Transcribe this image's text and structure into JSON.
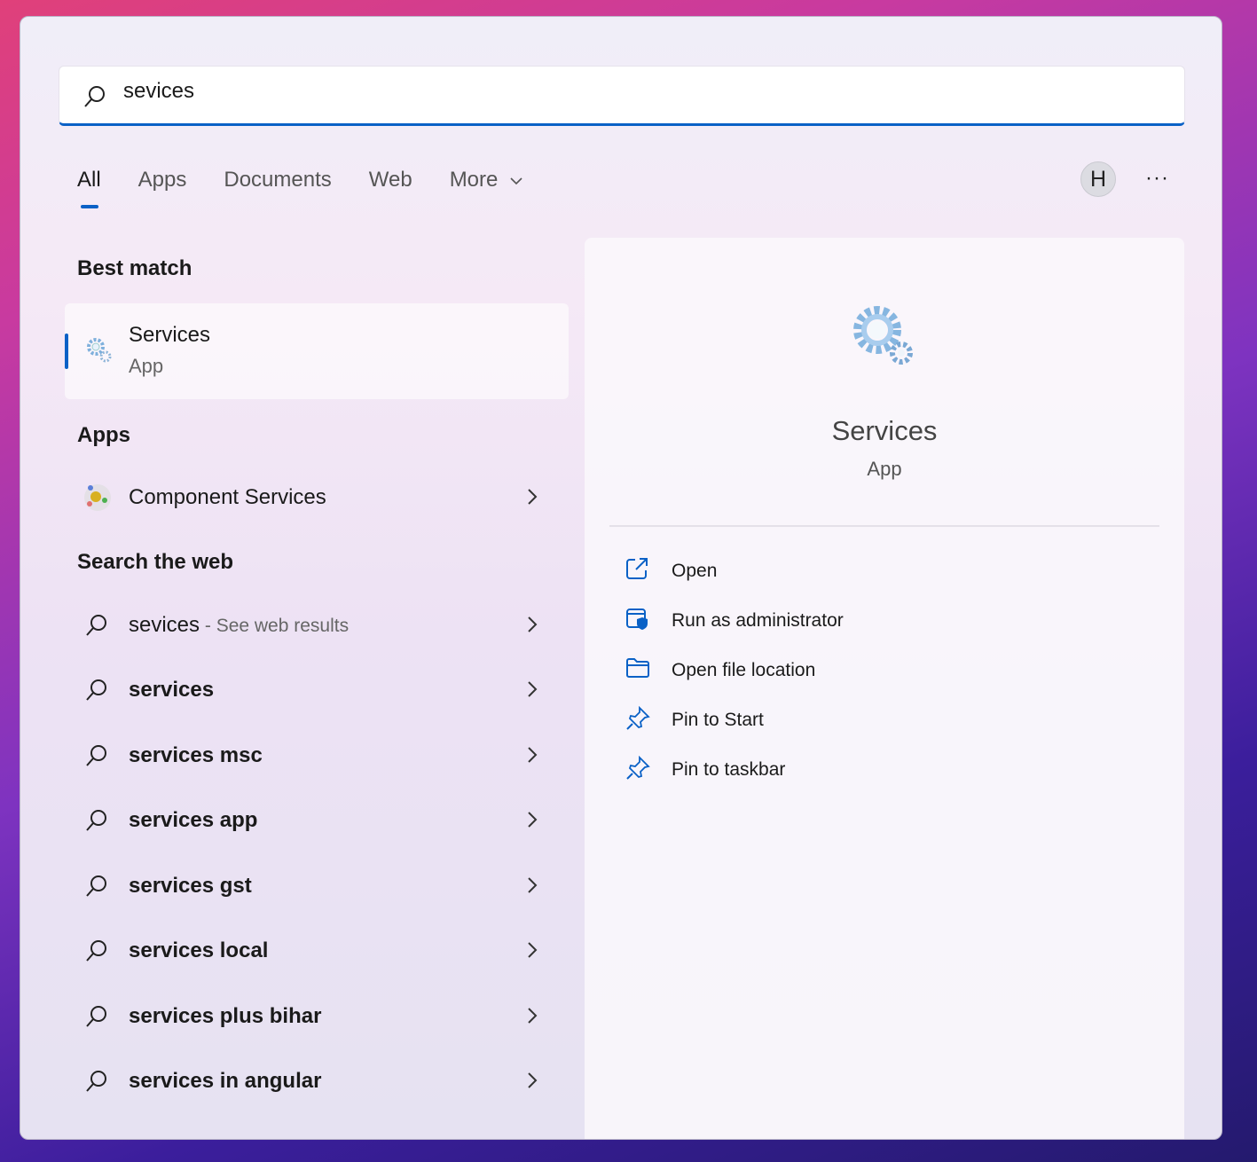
{
  "search": {
    "value": "sevices"
  },
  "tabs": [
    {
      "label": "All",
      "active": true
    },
    {
      "label": "Apps"
    },
    {
      "label": "Documents"
    },
    {
      "label": "Web"
    },
    {
      "label": "More"
    }
  ],
  "user": {
    "avatar_initial": "H",
    "more_options": "···"
  },
  "best_match": {
    "heading": "Best match",
    "title": "Services",
    "subtitle": "App",
    "icon": "services-gears-icon"
  },
  "apps": {
    "heading": "Apps",
    "items": [
      {
        "label": "Component Services",
        "icon": "component-services-icon"
      }
    ]
  },
  "web": {
    "heading": "Search the web",
    "first": {
      "query": "sevices",
      "suffix": " - See web results"
    },
    "suggestions": [
      "services",
      "services msc",
      "services app",
      "services gst",
      "services local",
      "services plus bihar",
      "services in angular"
    ]
  },
  "detail": {
    "title": "Services",
    "subtitle": "App",
    "actions": [
      {
        "label": "Open",
        "icon": "open-external-icon"
      },
      {
        "label": "Run as administrator",
        "icon": "shield-window-icon"
      },
      {
        "label": "Open file location",
        "icon": "folder-icon"
      },
      {
        "label": "Pin to Start",
        "icon": "pin-icon"
      },
      {
        "label": "Pin to taskbar",
        "icon": "pin-icon"
      }
    ]
  },
  "colors": {
    "accent": "#0a61c6"
  }
}
